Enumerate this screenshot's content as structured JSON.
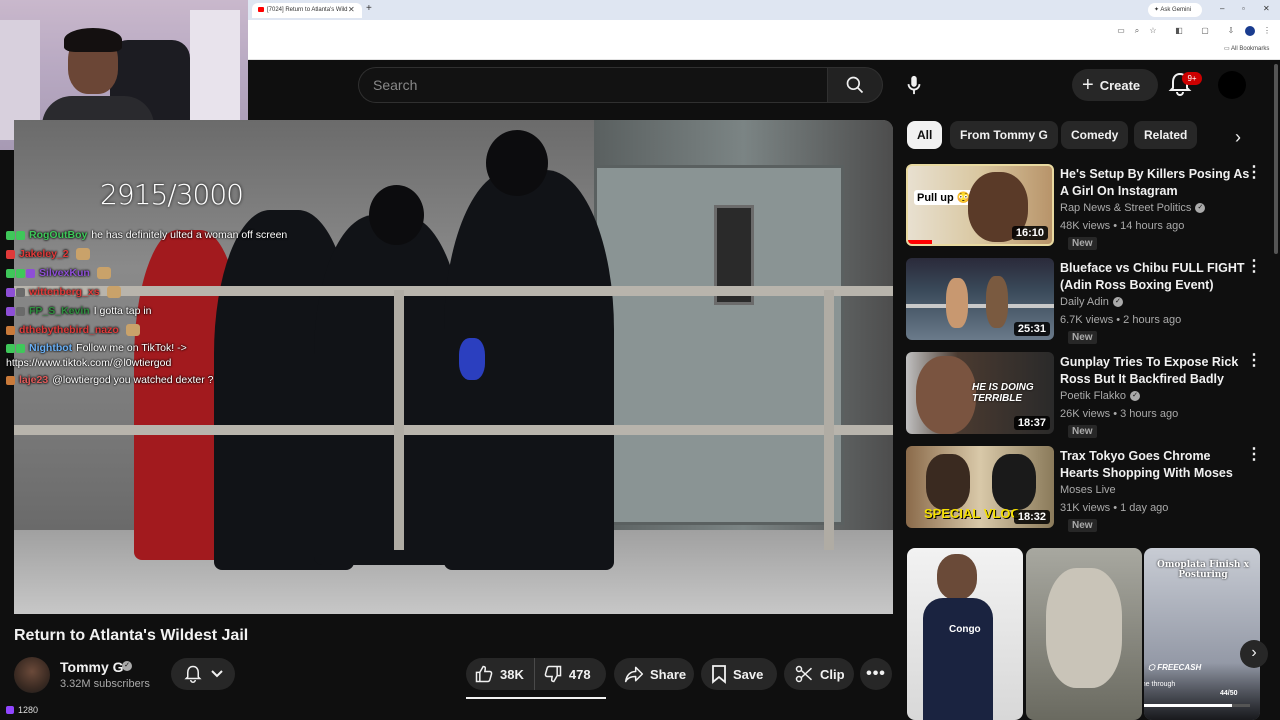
{
  "browser": {
    "tab_title": "[7024] Return to Atlanta's Wild",
    "tab_close": "✕",
    "new_tab": "+",
    "gemini_label": "✦ Ask Gemini",
    "bookmarks_label": "All Bookmarks"
  },
  "header": {
    "search_placeholder": "Search",
    "create_label": "Create",
    "notification_badge": "9+"
  },
  "stream_overlay": {
    "viewer_goal": "2915/3000",
    "bottom_count": "1280",
    "chat": [
      {
        "user": "RogOutBoy",
        "user_color": "#3fc75a",
        "message": "he has definitely ulted a woman off screen"
      },
      {
        "user": "Jakeley_2",
        "user_color": "#e03a3a",
        "message": ""
      },
      {
        "user": "SilvexKun",
        "user_color": "#8e4fd6",
        "message": ""
      },
      {
        "user": "wittenberg_xs",
        "user_color": "#e03a3a",
        "message": ""
      },
      {
        "user": "FP_S_Kevin",
        "user_color": "#2f8f3f",
        "message": "I gotta tap in"
      },
      {
        "user": "dthebythebird_nazo",
        "user_color": "#e03a3a",
        "message": ""
      },
      {
        "user": "Nightbot",
        "user_color": "#6ab0f5",
        "message": "Follow me on TikTok! ->"
      },
      {
        "user": "",
        "user_color": "#ffffff",
        "message": "https://www.tiktok.com/@l0wtiergod"
      },
      {
        "user": "laje23",
        "user_color": "#e05a5a",
        "message": "@lowtiergod you watched dexter ?"
      }
    ]
  },
  "video": {
    "title": "Return to Atlanta's Wildest Jail",
    "channel_name": "Tommy G",
    "subscribers": "3.32M subscribers",
    "likes": "38K",
    "dislikes": "478",
    "share_label": "Share",
    "save_label": "Save",
    "clip_label": "Clip"
  },
  "chips": [
    "All",
    "From Tommy G",
    "Comedy",
    "Related"
  ],
  "recommendations": [
    {
      "title": "He's Setup By Killers Posing As A Girl On Instagram",
      "channel": "Rap News & Street Politics",
      "views": "48K views • 14 hours ago",
      "badge": "New",
      "duration": "16:10",
      "thumb_text": "Pull up 😳"
    },
    {
      "title": "Blueface vs Chibu FULL FIGHT (Adin Ross Boxing Event)",
      "channel": "Daily Adin",
      "views": "6.7K views • 2 hours ago",
      "badge": "New",
      "duration": "25:31",
      "thumb_text": ""
    },
    {
      "title": "Gunplay Tries To Expose Rick Ross But It Backfired Badly",
      "channel": "Poetik Flakko",
      "views": "26K views • 3 hours ago",
      "badge": "New",
      "duration": "18:37",
      "thumb_text": "HE IS DOING TERRIBLE"
    },
    {
      "title": "Trax Tokyo Goes Chrome Hearts Shopping With Moses",
      "channel": "Moses Live",
      "views": "31K views • 1 day ago",
      "badge": "New",
      "duration": "18:32",
      "thumb_text": "SPECIAL VLOG"
    }
  ],
  "shorts": [
    {
      "caption": "Congo",
      "extra": ""
    },
    {
      "caption": "",
      "extra": ""
    },
    {
      "caption": "Omoplata Finish x Posturing",
      "extra": "Install a game through Freecash",
      "brand": "FREECASH",
      "counter": "44/50"
    }
  ],
  "colors": {
    "background": "#0f0f0f",
    "surface": "#272727",
    "text_primary": "#f1f1f1",
    "text_secondary": "#aaaaaa",
    "notification_red": "#cc0000"
  }
}
